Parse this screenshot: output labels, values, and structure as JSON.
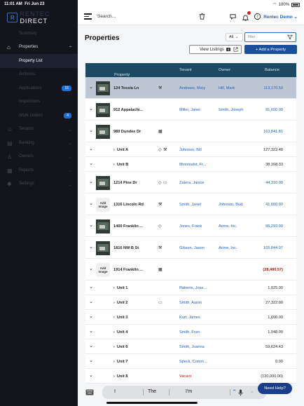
{
  "status_bar": {
    "time": "11:01 AM",
    "date": "Fri Jun 23",
    "battery": "100%"
  },
  "logo": {
    "mark": "R",
    "text_a": "RENTEC",
    "text_b": " DIRECT"
  },
  "sidebar": {
    "items": [
      {
        "label": "Summary",
        "type": "sub",
        "state": "dim"
      },
      {
        "label": "Properties",
        "type": "parent",
        "state": "active-parent",
        "icon": "home-icon",
        "chevron": "up"
      },
      {
        "label": "Property List",
        "type": "sub",
        "state": "active"
      },
      {
        "label": "Archives",
        "type": "sub",
        "state": "dim"
      },
      {
        "label": "Applications",
        "type": "sub",
        "state": "dim",
        "badge": "15"
      },
      {
        "label": "Inspections",
        "type": "sub",
        "state": "dim"
      },
      {
        "label": "Work Orders",
        "type": "sub",
        "state": "dim",
        "badge": "4"
      },
      {
        "label": "Tenants",
        "type": "parent",
        "state": "dim",
        "icon": "people-icon",
        "chevron": "down"
      },
      {
        "label": "Banking",
        "type": "parent",
        "state": "dim",
        "icon": "bank-icon",
        "chevron": "down"
      },
      {
        "label": "Owners",
        "type": "parent",
        "state": "dim",
        "icon": "owner-icon",
        "chevron": "down"
      },
      {
        "label": "Reports",
        "type": "parent",
        "state": "dim",
        "icon": "report-icon",
        "chevron": "down"
      },
      {
        "label": "Settings",
        "type": "parent",
        "state": "dim",
        "icon": "gear-icon",
        "chevron": "down"
      }
    ]
  },
  "topbar": {
    "search_label": "Search...",
    "user": "Rentec Demo",
    "notification_count": "1"
  },
  "page": {
    "title": "Properties",
    "filter_select": "All",
    "filter_placeholder": "filter",
    "view_listings": "View Listings",
    "view_listings_count": "4",
    "add_property": "+ Add a Property"
  },
  "table": {
    "headers": {
      "property": "Property",
      "tenant": "Tenant",
      "owner": "Owner",
      "balance": "Balance"
    },
    "rows": [
      {
        "kind": "property",
        "image": "photo",
        "name": "124 Tessia Ln",
        "icons": [
          "wrench-icon"
        ],
        "tenant": "Andrews, Mary",
        "owner": "Hill, Mark",
        "balance": "113,170.50",
        "bal_style": "link",
        "selected": true
      },
      {
        "kind": "property",
        "image": "photo",
        "name": "912 Appalachi...",
        "icons": [],
        "tenant": "Miller, Janet",
        "owner": "Smith, Joseph",
        "balance": "81,600.00",
        "bal_style": "link"
      },
      {
        "kind": "property",
        "image": "photo",
        "name": "989 Dundee Dr",
        "icons": [
          "building-icon"
        ],
        "tenant": "",
        "owner": "",
        "balance": "163,841.81",
        "bal_style": "link"
      },
      {
        "kind": "unit",
        "name": "Unit A",
        "icons": [
          "tag-icon",
          "wrench-icon"
        ],
        "tenant": "Johnson, Bill",
        "owner": "",
        "balance": "127,323.48",
        "bal_style": "plain"
      },
      {
        "kind": "unit",
        "name": "Unit B",
        "icons": [],
        "tenant": "Movesalot, Fr...",
        "owner": "",
        "balance": "38,168.33",
        "bal_style": "plain"
      },
      {
        "kind": "property",
        "image": "photo",
        "name": "1214 Pine Dr",
        "icons": [
          "tag-icon",
          "note-icon"
        ],
        "tenant": "Zatera, Janice",
        "owner": "",
        "balance": "44,310.00",
        "bal_style": "link"
      },
      {
        "kind": "property",
        "image": "add",
        "image_label_1": "Add",
        "image_label_2": "Image",
        "name": "1316 Lincoln Rd",
        "icons": [
          "wrench-icon"
        ],
        "tenant": "Smith, Janet",
        "owner": "Johnson, Bud",
        "balance": "41,000.00",
        "bal_style": "link"
      },
      {
        "kind": "property",
        "image": "photo",
        "name": "1400 Franklin ...",
        "icons": [
          "tag-icon"
        ],
        "tenant": "Jones, Frank",
        "owner": "Acme, Inc.",
        "balance": "95,293.00",
        "bal_style": "link"
      },
      {
        "kind": "property",
        "image": "photo",
        "name": "1816 NW B St",
        "icons": [
          "wrench-icon"
        ],
        "tenant": "Gibson, Jason",
        "owner": "Acme, Inc.",
        "balance": "165,844.97",
        "bal_style": "link"
      },
      {
        "kind": "property",
        "image": "add",
        "image_label_1": "Add",
        "image_label_2": "Image",
        "name": "1914 Franklin ...",
        "icons": [
          "building-icon"
        ],
        "tenant": "",
        "owner": "",
        "balance": "(28,480.57)",
        "bal_style": "neg"
      },
      {
        "kind": "unit",
        "name": "Unit 1",
        "icons": [],
        "tenant": "Roberts, Jose...",
        "owner": "",
        "balance": "1,925.00",
        "bal_style": "plain"
      },
      {
        "kind": "unit",
        "name": "Unit 2",
        "icons": [
          "note-icon"
        ],
        "tenant": "Smith, Aaron",
        "owner": "",
        "balance": "27,322.00",
        "bal_style": "plain"
      },
      {
        "kind": "unit",
        "name": "Unit 3",
        "icons": [],
        "tenant": "Kurt, James",
        "owner": "",
        "balance": "1,600.00",
        "bal_style": "plain"
      },
      {
        "kind": "unit",
        "name": "Unit 4",
        "icons": [],
        "tenant": "Smith, Fran",
        "owner": "",
        "balance": "1,048.00",
        "bal_style": "plain"
      },
      {
        "kind": "unit",
        "name": "Unit 6",
        "icons": [],
        "tenant": "Smith, Joanna",
        "owner": "",
        "balance": "59,624.43",
        "bal_style": "plain"
      },
      {
        "kind": "unit",
        "name": "Unit 7",
        "icons": [],
        "tenant": "Speck, Comm...",
        "owner": "",
        "balance": "0.00",
        "bal_style": "plain"
      },
      {
        "kind": "unit",
        "name": "Unit 8",
        "icons": [],
        "tenant": "Vacant",
        "tenant_style": "vacant",
        "owner": "",
        "balance": "(120,000.00)",
        "bal_style": "plain"
      }
    ]
  },
  "keyboard": {
    "suggestions": [
      "I",
      "The",
      "I'm"
    ]
  },
  "help_button": "Need Help?"
}
